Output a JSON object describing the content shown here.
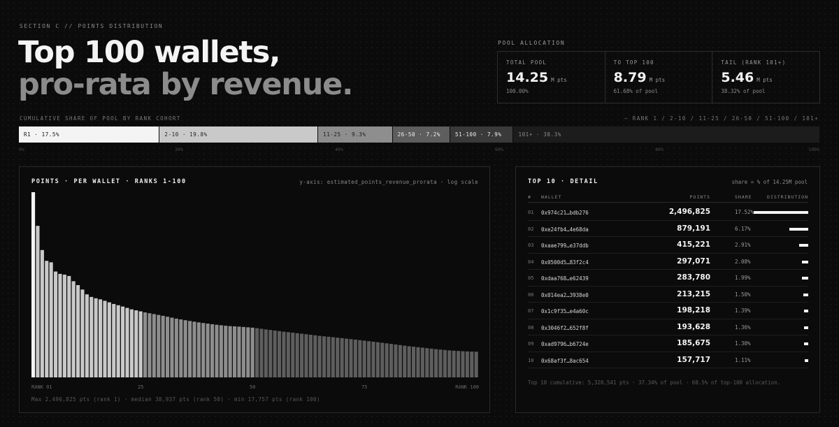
{
  "header": {
    "eyebrow": "SECTION C  //  POINTS DISTRIBUTION",
    "title_line1": "Top 100 wallets,",
    "title_line2": "pro-rata by revenue."
  },
  "pool": {
    "title": "POOL ALLOCATION",
    "cells": [
      {
        "label": "TOTAL POOL",
        "value": "14.25",
        "unit": "M pts",
        "sub": "100.00%"
      },
      {
        "label": "TO TOP 100",
        "value": "8.79",
        "unit": "M pts",
        "sub": "61.68%  of pool"
      },
      {
        "label": "TAIL (RANK 101+)",
        "value": "5.46",
        "unit": "M pts",
        "sub": "38.32%  of pool"
      }
    ]
  },
  "cumulative": {
    "title": "CUMULATIVE SHARE OF POOL BY RANK COHORT",
    "legend": "— RANK 1 / 2-10 / 11-25 / 26-50 / 51-100 / 101+",
    "segments": [
      {
        "label": "R1 · 17.5%",
        "share": 17.5,
        "bg": "#f4f4f4",
        "fg": "#111111"
      },
      {
        "label": "2-10 · 19.8%",
        "share": 19.8,
        "bg": "#c9c9c9",
        "fg": "#222222"
      },
      {
        "label": "11-25 · 9.3%",
        "share": 9.3,
        "bg": "#8e8e8e",
        "fg": "#1a1a1a"
      },
      {
        "label": "26-50 · 7.2%",
        "share": 7.2,
        "bg": "#5e5e5e",
        "fg": "#f0f0f0"
      },
      {
        "label": "51-100 · 7.9%",
        "share": 7.9,
        "bg": "#3a3a3a",
        "fg": "#f0f0f0"
      },
      {
        "label": "101+ · 38.3%",
        "share": 38.3,
        "bg": "#1c1c1c",
        "fg": "#8a8a8a"
      }
    ],
    "ticks": [
      "0%",
      "20%",
      "40%",
      "60%",
      "80%",
      "100%"
    ]
  },
  "left_panel": {
    "title": "POINTS · PER WALLET · RANKS 1-100",
    "axis_note": "y-axis: estimated_points_revenue_prorata · log scale",
    "footnote": "Max 2,496,825 pts (rank 1) · median 38,937 pts (rank 50) · min 17,757 pts (rank 100)"
  },
  "chart_data": {
    "type": "bar",
    "title": "POINTS · PER WALLET · RANKS 1-100",
    "ylabel": "estimated_points_revenue_prorata",
    "yscale": "log",
    "xlabel": "",
    "x_tick_labels": [
      "RANK 01",
      "25",
      "50",
      "75",
      "RANK 100"
    ],
    "x_tick_ranks": [
      1,
      25,
      50,
      75,
      100
    ],
    "ylim": [
      8000,
      2496825
    ],
    "cohort_colors": {
      "1": "#f4f4f4",
      "2-25": "#c9c9c9",
      "26-50": "#8e8e8e",
      "51-100": "#5e5e5e"
    },
    "categories_rank_range": [
      1,
      100
    ],
    "values": [
      2496825,
      879191,
      415221,
      297071,
      283780,
      213215,
      198218,
      193628,
      185675,
      157717,
      140000,
      122000,
      105000,
      97000,
      93000,
      90000,
      86000,
      82000,
      78000,
      75000,
      72000,
      69000,
      66000,
      64000,
      62000,
      60000,
      58500,
      57000,
      55500,
      54000,
      52500,
      51000,
      49500,
      48300,
      47100,
      46000,
      45000,
      44000,
      43200,
      42400,
      41600,
      40900,
      40300,
      39700,
      39200,
      38937,
      38600,
      38200,
      37800,
      37400,
      36800,
      36100,
      35400,
      34800,
      34200,
      33600,
      33000,
      32500,
      32000,
      31500,
      31000,
      30500,
      30000,
      29500,
      29000,
      28600,
      28200,
      27800,
      27400,
      27000,
      26600,
      26200,
      25800,
      25400,
      25000,
      24600,
      24200,
      23800,
      23400,
      23000,
      22600,
      22200,
      21800,
      21400,
      21000,
      20700,
      20400,
      20100,
      19800,
      19500,
      19200,
      18950,
      18700,
      18500,
      18300,
      18150,
      18000,
      17900,
      17820,
      17757
    ]
  },
  "right_panel": {
    "title": "TOP 10 · DETAIL",
    "note": "share = % of 14.25M pool",
    "headers": {
      "rank": "#",
      "wallet": "WALLET",
      "points": "POINTS",
      "share": "SHARE",
      "dist": "DISTRIBUTION"
    },
    "rows": [
      {
        "rank": "01",
        "wallet": "0x974c21…bdb276",
        "points": "2,496,825",
        "share": "17.52%",
        "share_value": 17.52
      },
      {
        "rank": "02",
        "wallet": "0xe24fb4…4e68da",
        "points": "879,191",
        "share": "6.17%",
        "share_value": 6.17
      },
      {
        "rank": "03",
        "wallet": "0xaae799…e37ddb",
        "points": "415,221",
        "share": "2.91%",
        "share_value": 2.91
      },
      {
        "rank": "04",
        "wallet": "0x0500d5…83f2c4",
        "points": "297,071",
        "share": "2.08%",
        "share_value": 2.08
      },
      {
        "rank": "05",
        "wallet": "0xdaa768…e62439",
        "points": "283,780",
        "share": "1.99%",
        "share_value": 1.99
      },
      {
        "rank": "06",
        "wallet": "0x014ea2…3938e0",
        "points": "213,215",
        "share": "1.50%",
        "share_value": 1.5
      },
      {
        "rank": "07",
        "wallet": "0x1c9f35…e4a60c",
        "points": "198,218",
        "share": "1.39%",
        "share_value": 1.39
      },
      {
        "rank": "08",
        "wallet": "0x3046f2…652f8f",
        "points": "193,628",
        "share": "1.36%",
        "share_value": 1.36
      },
      {
        "rank": "09",
        "wallet": "0xad9796…b6724e",
        "points": "185,675",
        "share": "1.30%",
        "share_value": 1.3
      },
      {
        "rank": "10",
        "wallet": "0x68af3f…8ac654",
        "points": "157,717",
        "share": "1.11%",
        "share_value": 1.11
      }
    ],
    "footnote": "Top 10 cumulative: 5,320,541 pts · 37.34% of pool · 60.5% of top-100 allocation."
  }
}
